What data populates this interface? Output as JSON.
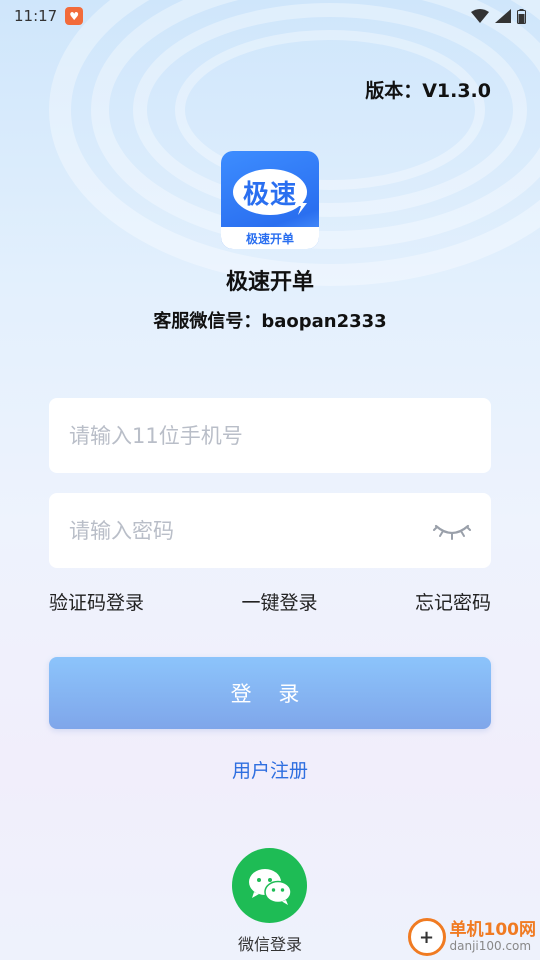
{
  "status_bar": {
    "time": "11:17"
  },
  "version": "版本：V1.3.0",
  "logo": {
    "main_text": "极速",
    "band_text": "极速开单"
  },
  "app_name": "极速开单",
  "service_wechat": "客服微信号：baopan2333",
  "phone_input": {
    "placeholder": "请输入11位手机号",
    "value": ""
  },
  "password_input": {
    "placeholder": "请输入密码",
    "value": ""
  },
  "links": {
    "sms_login": "验证码登录",
    "one_click_login": "一键登录",
    "forgot_password": "忘记密码"
  },
  "login_button": "登 录",
  "register_link": "用户注册",
  "wechat_login_label": "微信登录",
  "watermark": {
    "cn": "单机100网",
    "en": "danji100.com"
  },
  "colors": {
    "accent": "#2f6fe0",
    "login_button_top": "#8cc4fb",
    "login_button_bottom": "#7fa6ea",
    "wechat_green": "#1ebc55",
    "watermark_orange": "#f07b22"
  }
}
